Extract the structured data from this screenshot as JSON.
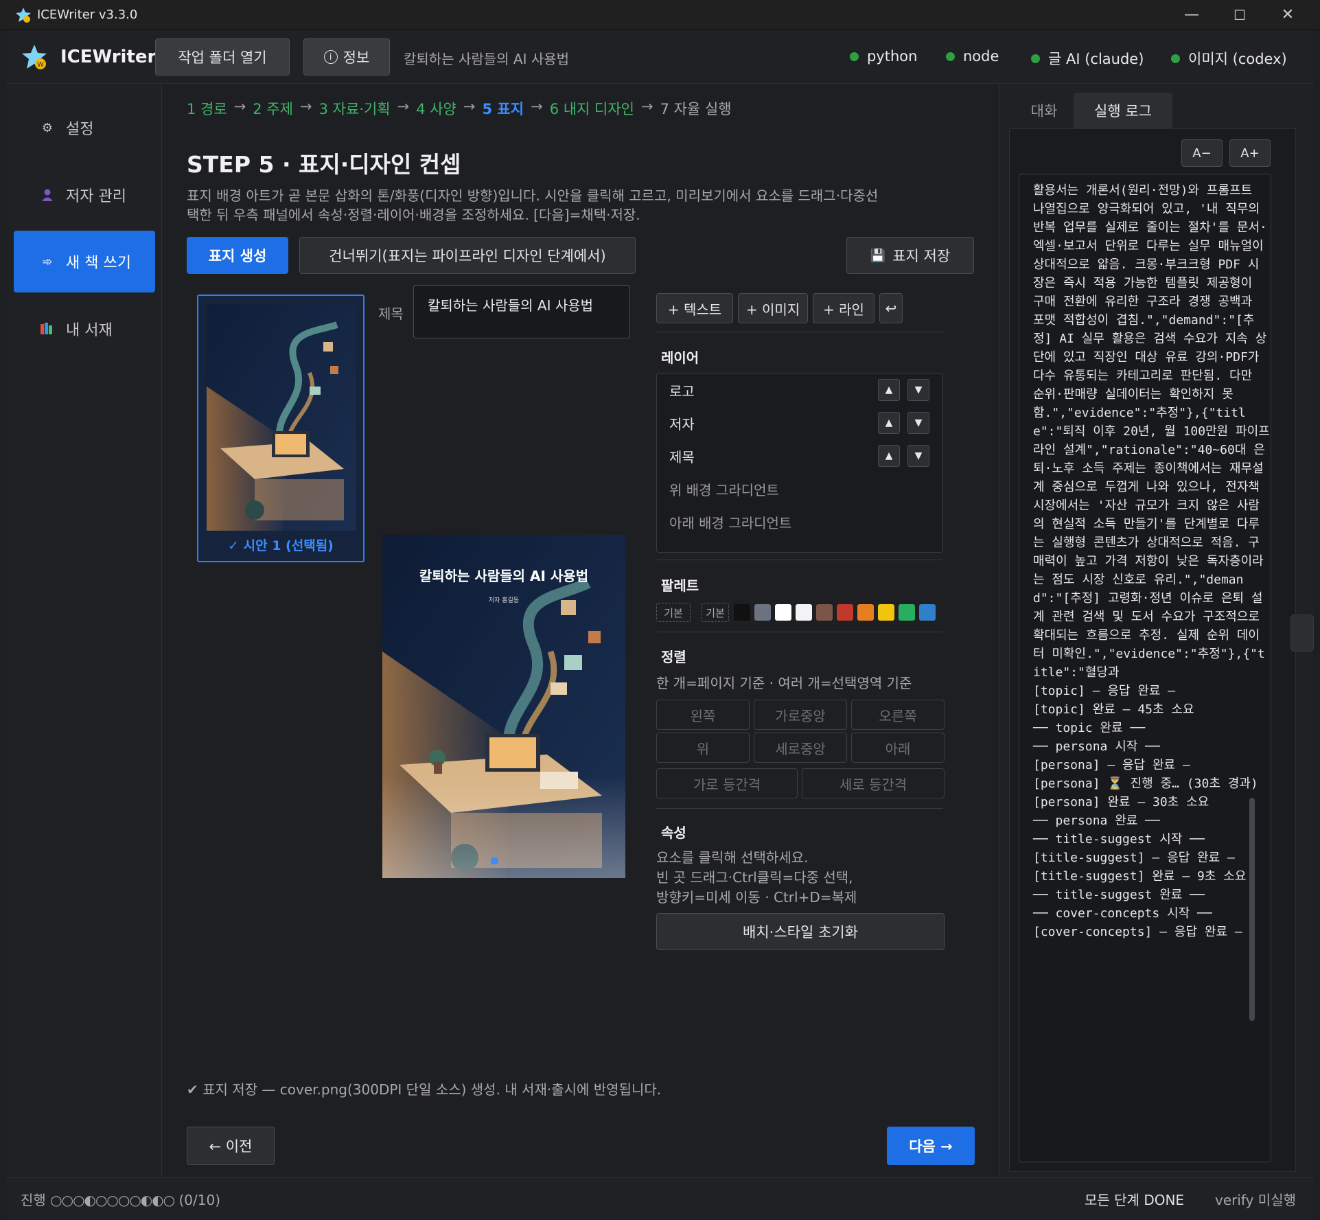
{
  "window": {
    "title": "ICEWriter v3.3.0",
    "minimize": "—",
    "maximize": "☐",
    "close": "✕"
  },
  "header": {
    "app_name": "ICEWriter",
    "open_folder": "작업 폴더 열기",
    "info": "정보",
    "book_title": "칼퇴하는 사람들의 AI 사용법",
    "status": [
      {
        "label": "python",
        "color": "#2ea043"
      },
      {
        "label": "node",
        "color": "#2ea043"
      },
      {
        "label": "글 AI (claude)",
        "color": "#2ea043"
      },
      {
        "label": "이미지 (codex)",
        "color": "#2ea043"
      }
    ]
  },
  "sidebar": {
    "items": [
      {
        "label": "설정",
        "icon": "gear-icon"
      },
      {
        "label": "저자 관리",
        "icon": "user-icon"
      },
      {
        "label": "새 책 쓰기",
        "icon": "arrow-icon",
        "active": true
      },
      {
        "label": "내 서재",
        "icon": "books-icon"
      }
    ]
  },
  "breadcrumb": {
    "steps": [
      "1 경로",
      "2 주제",
      "3 자료·기획",
      "4 사양",
      "5 표지",
      "6 내지 디자인",
      "7 자율 실행"
    ],
    "arrow": "→",
    "current": 4
  },
  "step": {
    "title": "STEP 5 · 표지·디자인 컨셉",
    "description": "표지 배경 아트가 곧 본문 삽화의 톤/화풍(디자인 방향)입니다. 시안을 클릭해 고르고, 미리보기에서 요소를 드래그·다중선택한 뒤 우측 패널에서 속성·정렬·레이어·배경을 조정하세요. [다음]=채택·저장."
  },
  "actions": {
    "generate": "표지 생성",
    "skip": "건너뛰기(표지는 파이프라인 디자인 단계에서)",
    "save": "표지 저장"
  },
  "concept": {
    "caption": "✓ 시안 1  (선택됨)"
  },
  "title_field": {
    "label": "제목",
    "value": "칼퇴하는 사람들의 AI 사용법"
  },
  "preview": {
    "title": "칼퇴하는 사람들의 AI 사용법",
    "author": "저자 홍길동"
  },
  "tools": {
    "add_text": "+ 텍스트",
    "add_image": "+ 이미지",
    "add_line": "+ 라인",
    "undo": "↩"
  },
  "layers": {
    "title": "레이어",
    "items": [
      {
        "label": "로고",
        "movable": true
      },
      {
        "label": "저자",
        "movable": true
      },
      {
        "label": "제목",
        "movable": true
      },
      {
        "label": "위 배경 그라디언트",
        "movable": false
      },
      {
        "label": "아래 배경 그라디언트",
        "movable": false
      }
    ],
    "up": "▲",
    "down": "▼"
  },
  "palette": {
    "title": "팔레트",
    "chips": [
      "기본",
      "기본"
    ],
    "colors": [
      "#111111",
      "#6b7280",
      "#ffffff",
      "#f3f3f3",
      "#7a5548",
      "#c0392b",
      "#e67e22",
      "#f1c40f",
      "#27ae60",
      "#2f80c9"
    ]
  },
  "align": {
    "title": "정렬",
    "hint": "한 개=페이지 기준 · 여러 개=선택영역 기준",
    "left": "왼쪽",
    "hcenter": "가로중앙",
    "right": "오른쪽",
    "top": "위",
    "vcenter": "세로중앙",
    "bottom": "아래",
    "hdist": "가로 등간격",
    "vdist": "세로 등간격"
  },
  "props": {
    "title": "속성",
    "line1": "요소를 클릭해 선택하세요.",
    "line2": "빈 곳 드래그·Ctrl클릭=다중 선택,",
    "line3": "방향키=미세 이동 · Ctrl+D=복제",
    "reset": "배치·스타일 초기화"
  },
  "status_message": "✔ 표지 저장 — cover.png(300DPI 단일 소스) 생성. 내 서재·출시에 반영됩니다.",
  "nav": {
    "prev": "← 이전",
    "next": "다음 →"
  },
  "right_panel": {
    "tabs": [
      "대화",
      "실행 로그"
    ],
    "active_tab": 1,
    "font_minus": "A−",
    "font_plus": "A+",
    "log": "활용서는 개론서(원리·전망)와 프롬프트 나열집으로 양극화되어 있고, '내 직무의 반복 업무를 실제로 줄이는 절차'를 문서·엑셀·보고서 단위로 다루는 실무 매뉴얼이 상대적으로 얇음. 크몽·부크크형 PDF 시장은 즉시 적용 가능한 템플릿 제공형이 구매 전환에 유리한 구조라 경쟁 공백과 포맷 적합성이 겹침.\",\"demand\":\"[추정] AI 실무 활용은 검색 수요가 지속 상단에 있고 직장인 대상 유료 강의·PDF가 다수 유통되는 카테고리로 판단됨. 다만 순위·판매량 실데이터는 확인하지 못함.\",\"evidence\":\"추정\"},{\"title\":\"퇴직 이후 20년, 월 100만원 파이프라인 설계\",\"rationale\":\"40~60대 은퇴·노후 소득 주제는 종이책에서는 재무설계 중심으로 두껍게 나와 있으나, 전자책 시장에서는 '자산 규모가 크지 않은 사람의 현실적 소득 만들기'를 단계별로 다루는 실행형 콘텐츠가 상대적으로 적음. 구매력이 높고 가격 저항이 낮은 독자층이라는 점도 시장 신호로 유리.\",\"demand\":\"[추정] 고령화·정년 이슈로 은퇴 설계 관련 검색 및 도서 수요가 구조적으로 확대되는 흐름으로 추정. 실제 순위 데이터 미확인.\",\"evidence\":\"추정\"},{\"title\":\"혈당과\n[topic] — 응답 완료 —\n[topic] 완료 — 45초 소요\n── topic 완료 ──\n── persona 시작 ──\n[persona] — 응답 완료 —\n[persona] ⏳ 진행 중… (30초 경과)\n[persona] 완료 — 30초 소요\n── persona 완료 ──\n── title-suggest 시작 ──\n[title-suggest] — 응답 완료 —\n[title-suggest] 완료 — 9초 소요\n── title-suggest 완료 ──\n── cover-concepts 시작 ──\n[cover-concepts] — 응답 완료 —"
  },
  "footer": {
    "progress_label": "진행",
    "progress_dots": "○○○◐○○○○◐◐○",
    "progress_count": "(0/10)",
    "all_done": "모든 단계 DONE",
    "verify": "verify 미실행"
  }
}
